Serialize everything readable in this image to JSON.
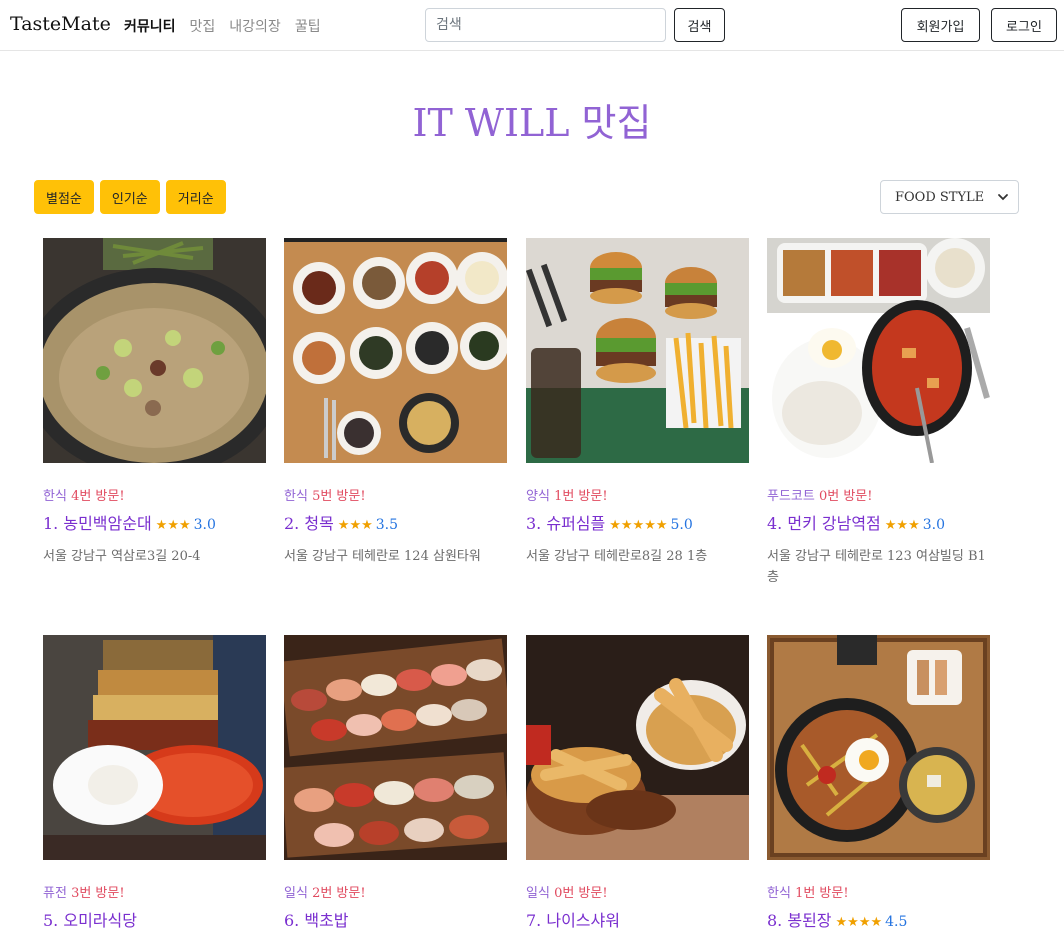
{
  "navbar": {
    "brand": "TasteMate",
    "links": [
      "커뮤니티",
      "맛집",
      "내강의장",
      "꿀팁"
    ],
    "search_placeholder": "검색",
    "search_button": "검색",
    "signup_button": "회원가입",
    "login_button": "로그인"
  },
  "page": {
    "title": "IT WILL 맛집"
  },
  "sort": {
    "buttons": [
      "별점순",
      "인기순",
      "거리순"
    ],
    "food_style": "FOOD STYLE"
  },
  "restaurants": [
    {
      "category": "한식",
      "visits": "4번 방문!",
      "name": "1. 농민백암순대",
      "stars": "★★★",
      "rating": "3.0",
      "address": "서울 강남구 역삼로3길 20-4"
    },
    {
      "category": "한식",
      "visits": "5번 방문!",
      "name": "2. 청목",
      "stars": "★★★",
      "rating": "3.5",
      "address": "서울 강남구 테헤란로 124 삼원타워"
    },
    {
      "category": "양식",
      "visits": "1번 방문!",
      "name": "3. 슈퍼심플",
      "stars": "★★★★★",
      "rating": "5.0",
      "address": "서울 강남구 테헤란로8길 28 1층"
    },
    {
      "category": "푸드코트",
      "visits": "0번 방문!",
      "name": "4. 먼키 강남역점",
      "stars": "★★★",
      "rating": "3.0",
      "address": "서울 강남구 테헤란로 123 여삼빌딩 B1층"
    },
    {
      "category": "퓨전",
      "visits": "3번 방문!",
      "name": "5. 오미라식당",
      "stars": "",
      "rating": "",
      "address": ""
    },
    {
      "category": "일식",
      "visits": "2번 방문!",
      "name": "6. 백초밥",
      "stars": "",
      "rating": "",
      "address": ""
    },
    {
      "category": "일식",
      "visits": "0번 방문!",
      "name": "7. 나이스샤워",
      "stars": "",
      "rating": "",
      "address": ""
    },
    {
      "category": "한식",
      "visits": "1번 방문!",
      "name": "8. 봉된장",
      "stars": "★★★★",
      "rating": "4.5",
      "address": ""
    }
  ],
  "icons": {
    "select_chevron": "chevron-down-icon"
  }
}
